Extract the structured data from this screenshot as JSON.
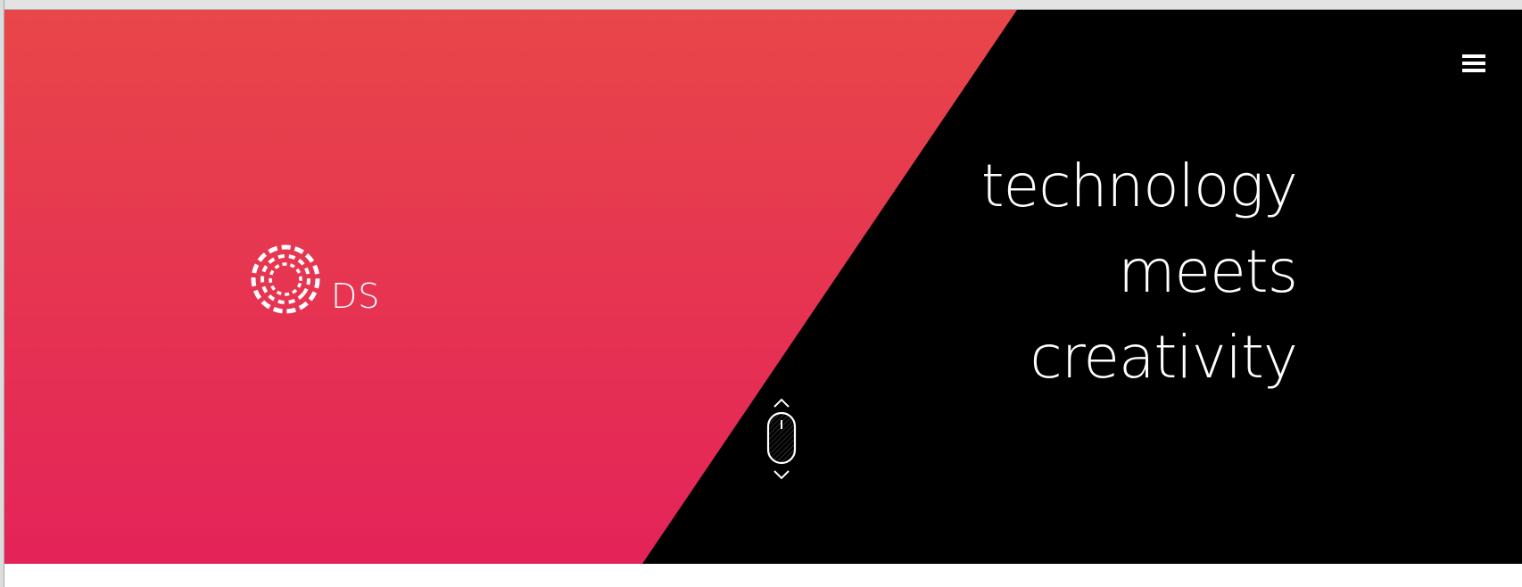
{
  "brand": {
    "logo_text": "DS",
    "logo_icon": "dashed-concentric-circles-icon"
  },
  "menu": {
    "icon": "hamburger-menu-icon"
  },
  "hero": {
    "tagline": [
      "technology",
      "meets",
      "creativity"
    ],
    "scroll_icon": "mouse-scroll-icon",
    "colors": {
      "gradient_top": "#e84649",
      "gradient_bottom": "#e42359",
      "dark_panel": "#000000",
      "text": "#ffffff"
    }
  }
}
